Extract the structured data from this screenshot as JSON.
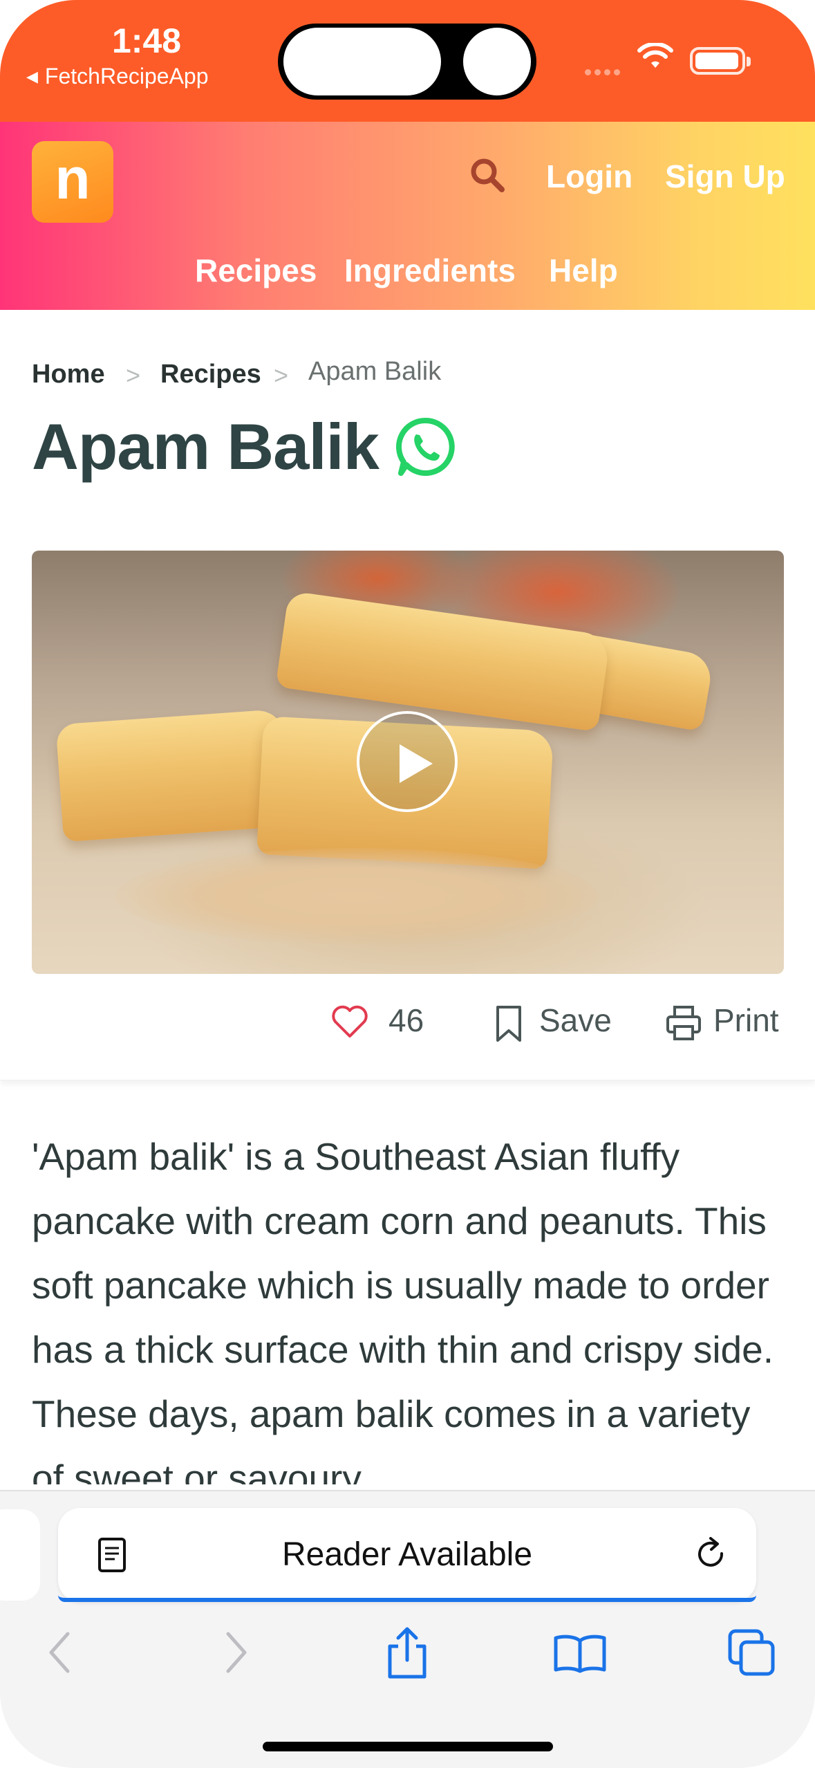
{
  "status_bar": {
    "time": "1:48",
    "back_app": "FetchRecipeApp",
    "back_glyph": "◀"
  },
  "header": {
    "logo_letter": "n",
    "login": "Login",
    "signup": "Sign Up",
    "nav": [
      "Recipes",
      "Ingredients",
      "Help"
    ]
  },
  "breadcrumb": {
    "items": [
      "Home",
      "Recipes",
      "Apam Balik"
    ],
    "separator": ">"
  },
  "page": {
    "title": "Apam Balik"
  },
  "actions": {
    "like_count": "46",
    "save": "Save",
    "print": "Print"
  },
  "description": "'Apam balik' is a Southeast Asian fluffy pancake with cream corn and peanuts. This soft pancake which is usually made to order has a thick surface with thin and crispy side. These days, apam balik comes in a variety of sweet or savoury",
  "browser": {
    "address_text": "Reader Available"
  },
  "icons": {
    "search": "search-icon",
    "whatsapp": "whatsapp-icon",
    "play": "play-icon",
    "like": "heart-icon",
    "save": "bookmark-icon",
    "print": "printer-icon",
    "reader": "reader-icon",
    "reload": "reload-icon",
    "back": "chevron-left-icon",
    "forward": "chevron-right-icon",
    "share": "share-icon",
    "bookmarks": "book-icon",
    "tabs": "tabs-icon"
  },
  "colors": {
    "status_bar": "#fd5c28",
    "header_gradient_start": "#ff3478",
    "header_gradient_end": "#ffe15e",
    "logo": "#ffa12c",
    "whatsapp": "#25d366",
    "heart": "#e23b50",
    "ios_blue": "#1a73e8"
  }
}
